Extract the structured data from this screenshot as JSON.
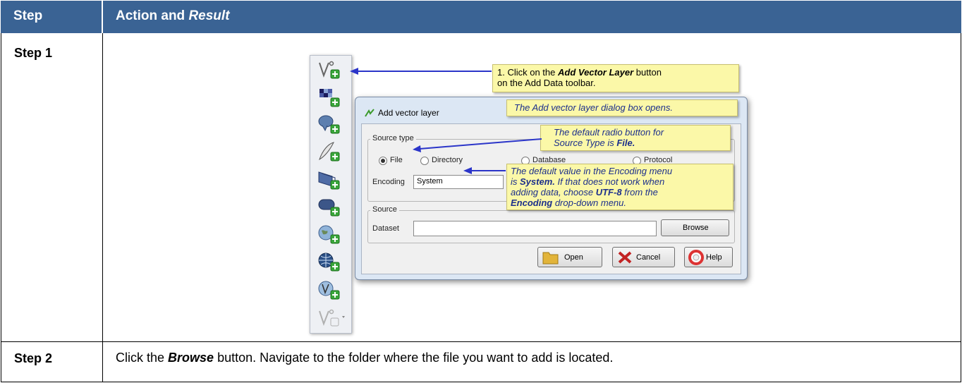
{
  "header": {
    "col_step": "Step",
    "col_action_prefix": "Action and ",
    "col_action_em": "Result"
  },
  "rows": [
    {
      "step": "Step 1"
    },
    {
      "step": "Step 2",
      "text_before": "Click the ",
      "text_em": "Browse",
      "text_after": " button. Navigate to the folder where the file you want to add is located."
    }
  ],
  "toolbar": {
    "icons": [
      "add-vector-layer-icon",
      "add-raster-layer-icon",
      "add-postgis-layer-icon",
      "add-spatialite-layer-icon",
      "add-mssql-layer-icon",
      "add-oracle-layer-icon",
      "add-wms-layer-icon",
      "add-wcs-layer-icon",
      "add-wfs-layer-icon",
      "add-vector-layer-dropdown-icon"
    ]
  },
  "dialog": {
    "title": "Add vector layer",
    "source_type_label": "Source type",
    "radio_file": "File",
    "radio_directory": "Directory",
    "radio_database": "Database",
    "radio_protocol": "Protocol",
    "encoding_label": "Encoding",
    "encoding_value": "System",
    "source_label": "Source",
    "dataset_label": "Dataset",
    "browse_label": "Browse",
    "open_label": "Open",
    "cancel_label": "Cancel",
    "help_label": "Help"
  },
  "callouts": {
    "c1_a": "1. Click on the ",
    "c1_b": "Add Vector Layer",
    "c1_c": " button",
    "c1_d": "on the Add Data toolbar.",
    "c2": "The Add vector layer dialog box opens.",
    "c3_a": "The default radio button for",
    "c3_b": "Source Type is ",
    "c3_c": "File.",
    "c4_a": "The default value in the Encoding menu",
    "c4_b": "is ",
    "c4_c": "System.",
    "c4_d": "  If that does not work when",
    "c4_e": "adding data, choose ",
    "c4_f": "UTF-8",
    "c4_g": " from the",
    "c4_h": "Encoding",
    "c4_i": " drop-down menu."
  },
  "colors": {
    "header_bg": "#3a6394",
    "callout_bg": "#fbf8a8",
    "arrow": "#2b35c9"
  }
}
